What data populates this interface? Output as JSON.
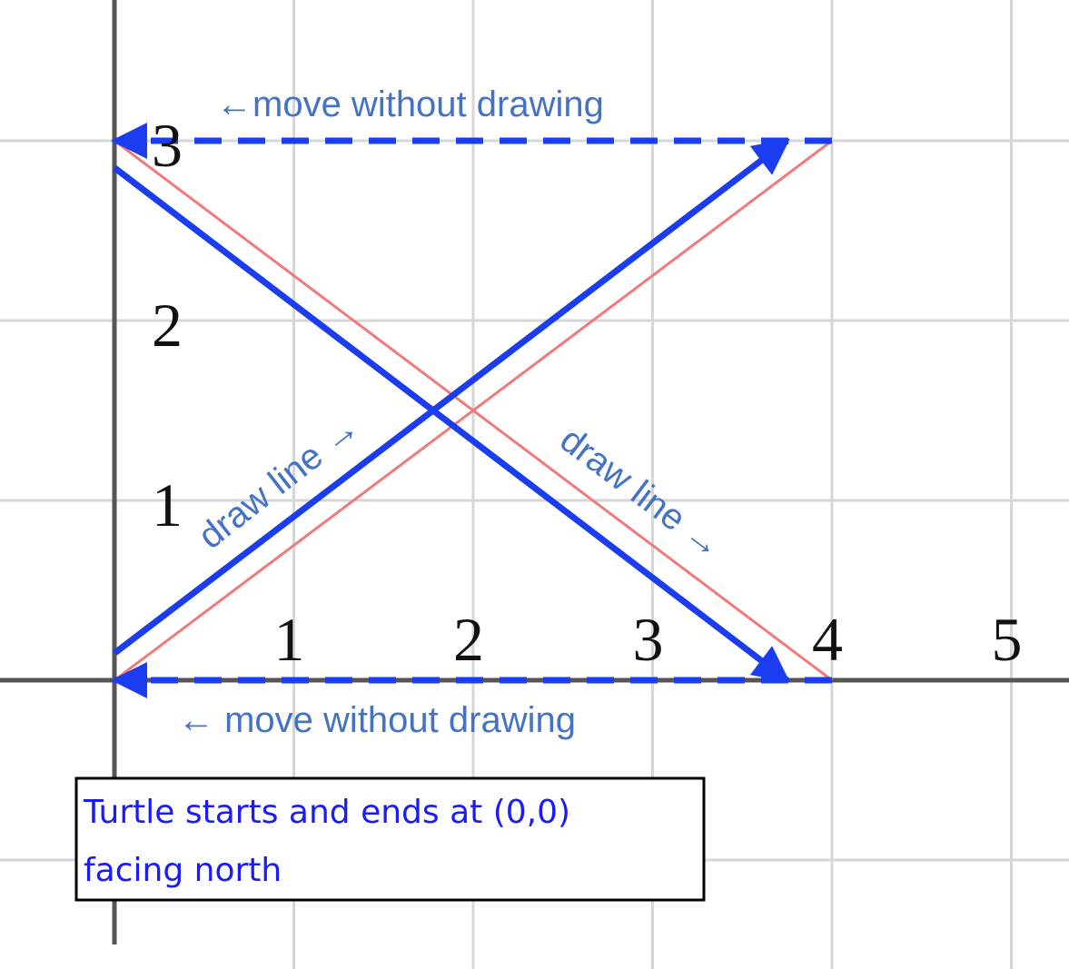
{
  "colors": {
    "grid": "#d6d6d6",
    "axis": "#555555",
    "path": "#1a3df0",
    "reference": "#f07a7a",
    "note": "#4472c4",
    "box_text": "#1a1aff"
  },
  "axes": {
    "x_ticks": [
      "1",
      "2",
      "3",
      "4",
      "5"
    ],
    "y_ticks": [
      "1",
      "2",
      "3"
    ]
  },
  "segments": [
    {
      "kind": "move",
      "from": [
        4,
        3
      ],
      "to": [
        0,
        3
      ]
    },
    {
      "kind": "draw",
      "from": [
        0,
        2.85
      ],
      "to": [
        3.75,
        0
      ]
    },
    {
      "kind": "move",
      "from": [
        4,
        0
      ],
      "to": [
        0,
        0
      ]
    },
    {
      "kind": "draw",
      "from": [
        0,
        0.15
      ],
      "to": [
        3.75,
        3
      ]
    }
  ],
  "reference_lines": [
    {
      "from": [
        0,
        0
      ],
      "to": [
        4,
        3
      ]
    },
    {
      "from": [
        0,
        3
      ],
      "to": [
        4,
        0
      ]
    }
  ],
  "annotations": {
    "move_top": "←move without drawing",
    "move_bottom": "← move without drawing",
    "draw_left": "draw  line →",
    "draw_right": "draw  line →"
  },
  "caption": {
    "line1": "Turtle starts and ends at (0,0)",
    "line2": "facing north"
  }
}
